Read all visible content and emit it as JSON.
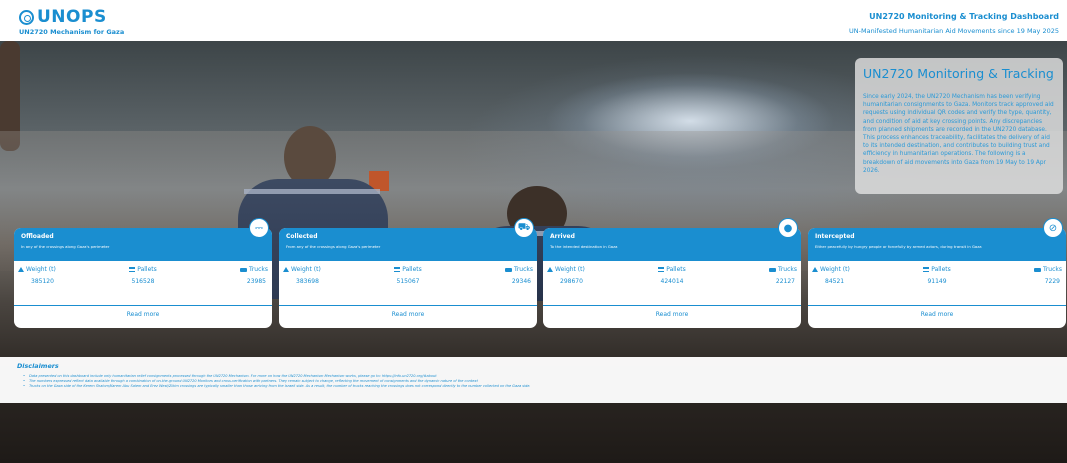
{
  "header": {
    "logo_text": "UNOPS",
    "subtitle": "UN2720 Mechanism for Gaza",
    "title": "UN2720 Monitoring & Tracking Dashboard",
    "tagline": "UN-Manifested Humanitarian Aid Movements since 19 May 2025"
  },
  "info_box": {
    "title": "UN2720 Monitoring & Tracking",
    "body": "Since early 2024, the UN2720 Mechanism has been verifying humanitarian consignments to Gaza. Monitors track approved aid requests using individual QR codes and verify the type, quantity, and condition of aid at key crossing points. Any discrepancies from planned shipments are recorded in the UN2720 database. This process enhances traceability, facilitates the delivery of aid to its intended destination, and contributes to building trust and efficiency in humanitarian operations. The following is a breakdown of aid movements into Gaza from 19 May to 19 Apr 2026."
  },
  "stat_labels": {
    "weight": "Weight (t)",
    "pallets": "Pallets",
    "trucks": "Trucks",
    "read_more": "Read more"
  },
  "cards": [
    {
      "title": "Offloaded",
      "description": "In any of the crossings along Gaza's perimeter",
      "icon": "offload-icon",
      "weight": "385120",
      "pallets": "516528",
      "trucks": "23985"
    },
    {
      "title": "Collected",
      "description": "From any of the crossings along Gaza's perimeter",
      "icon": "truck-collect-icon",
      "weight": "383698",
      "pallets": "515067",
      "trucks": "29346"
    },
    {
      "title": "Arrived",
      "description": "To the intended destination in Gaza",
      "icon": "truck-arrived-icon",
      "weight": "298670",
      "pallets": "424014",
      "trucks": "22127"
    },
    {
      "title": "Intercepted",
      "description": "Either peacefully by hungry people or forcefully by armed actors, during transit in Gaza",
      "icon": "intercept-icon",
      "weight": "84521",
      "pallets": "91149",
      "trucks": "7229"
    }
  ],
  "disclaimers": {
    "title": "Disclaimers",
    "items": [
      "Data presented on this dashboard include only humanitarian relief consignments processed through the UN2720 Mechanism. For more on how the UN2720 Mechanism Mechanism works, please go to: https://info.un2720.org/#about",
      "The numbers expressed reflect data available through a combination of on-the-ground UN2720 Monitors and cross-verification with partners. They remain subject to change, reflecting the movement of consignments and the dynamic nature of the context",
      "Trucks on the Gaza side of the Kerem Shalom/Karem Abu Salem and Erez West/Zikim crossings are typically smaller than those arriving from the Israeli side. As a result, the number of trucks reaching the crossings does not correspond directly to the number collected on the Gaza side."
    ]
  },
  "colors": {
    "brand": "#1a8ed0",
    "card_header": "#1a8ed0",
    "background": "#ffffff"
  }
}
